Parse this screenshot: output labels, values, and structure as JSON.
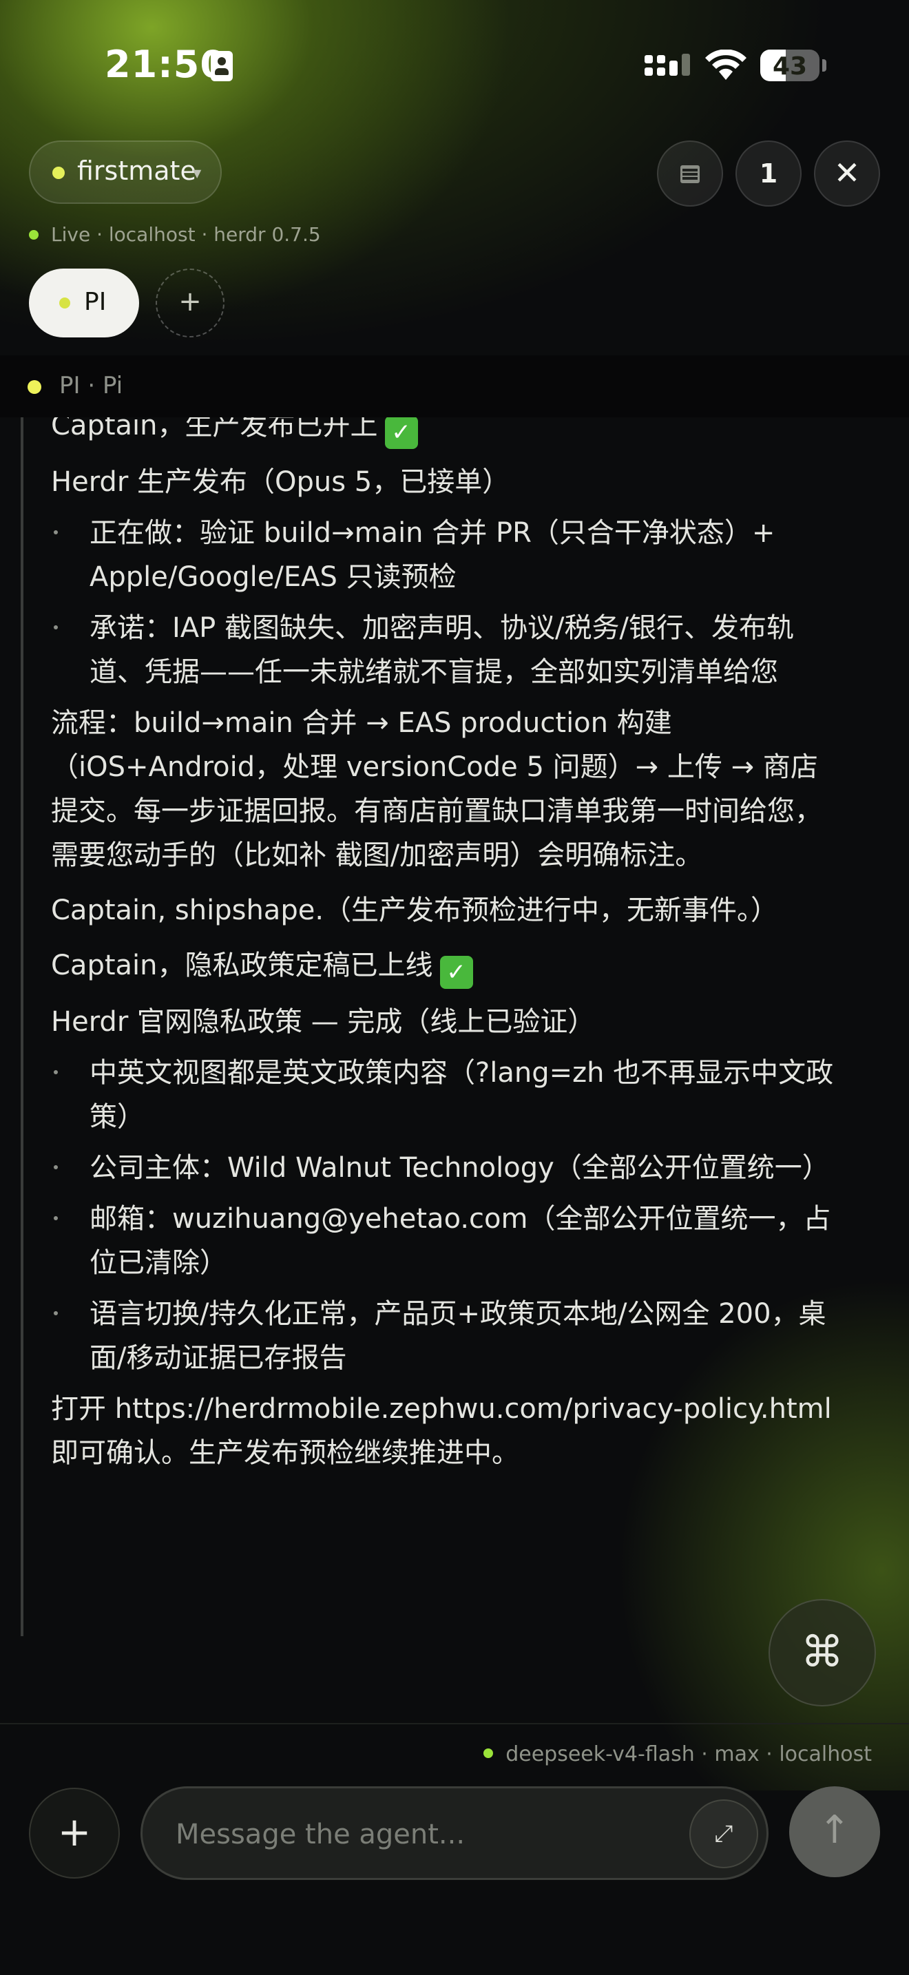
{
  "status_bar": {
    "time": "21:50",
    "battery": "43",
    "battery_level": 0.43
  },
  "header": {
    "agent_name": "firstmate",
    "count_badge": "1",
    "live_status": "Live · localhost · herdr 0.7.5",
    "icons": {
      "list": "list-icon",
      "close": "close-icon",
      "caret": "chevron-down-icon"
    }
  },
  "tabs": [
    {
      "label": "PI",
      "active": true
    }
  ],
  "session_label": "PI · Pi",
  "transcript": {
    "line_1": "Captain，生产发布已开上",
    "line_2": "Herdr 生产发布（Opus 5，已接单）",
    "bullets_a": [
      "正在做：验证 build→main 合并 PR（只合干净状态）+ Apple/Google/EAS 只读预检",
      "承诺：IAP 截图缺失、加密声明、协议/税务/银行、发布轨道、凭据——任一未就绪就不盲提，全部如实列清单给您"
    ],
    "flow": "流程：build→main 合并 → EAS production 构建（iOS+Android，处理 versionCode 5 问题）→ 上传 → 商店提交。每一步证据回报。有商店前置缺口清单我第一时间给您，需要您动手的（比如补 截图/加密声明）会明确标注。",
    "shipshape": "Captain, shipshape.（生产发布预检进行中，无新事件。）",
    "privacy_title": "Captain，隐私政策定稿已上线",
    "privacy_sub": "Herdr 官网隐私政策 — 完成（线上已验证）",
    "bullets_b": [
      "中英文视图都是英文政策内容（?lang=zh 也不再显示中文政策）",
      "公司主体：Wild Walnut Technology（全部公开位置统一）",
      "邮箱：wuzihuang@yehetao.com（全部公开位置统一，占位已清除）",
      "语言切换/持久化正常，产品页+政策页本地/公网全 200，桌面/移动证据已存报告"
    ],
    "closing": "打开 https://herdrmobile.zephwu.com/privacy-policy.html 即可确认。生产发布预检继续推进中。"
  },
  "command_button": {
    "glyph": "⌘"
  },
  "composer": {
    "model_status": "deepseek-v4-flash · max · localhost",
    "placeholder": "Message the agent...",
    "value": "",
    "add_glyph": "+",
    "expand_glyph": "⤢",
    "send_glyph": "↑"
  },
  "colors": {
    "accent_green": "#9be33a",
    "tab_dot": "#d7e344",
    "background": "#0b0c0d"
  }
}
